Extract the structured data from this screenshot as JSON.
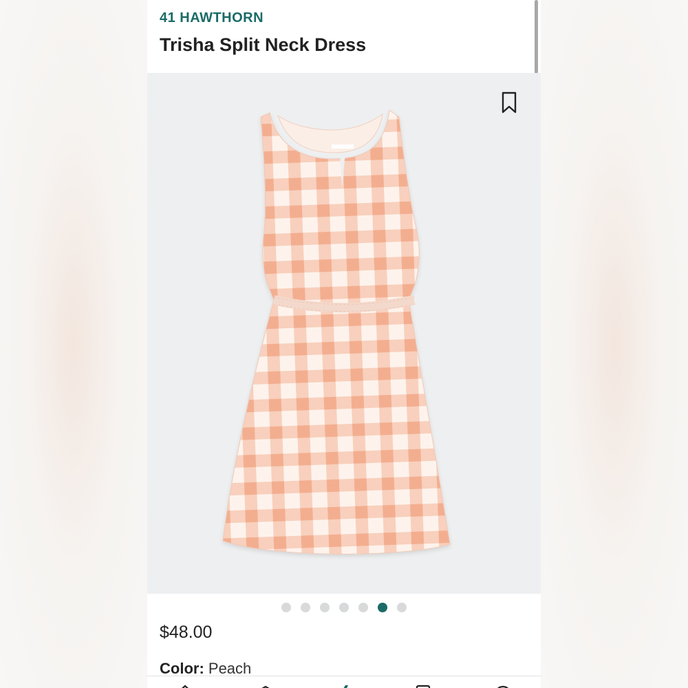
{
  "product": {
    "brand": "41 HAWTHORN",
    "name": "Trisha Split Neck Dress",
    "price": "$48.00",
    "color_label": "Color:",
    "color_value": "Peach"
  },
  "gallery": {
    "image_count": 7,
    "active_index": 5,
    "bookmark_icon": "bookmark-icon"
  },
  "bottom_nav": {
    "icons": [
      "home-icon",
      "box-icon",
      "stitchfix-icon",
      "bag-icon",
      "account-icon"
    ]
  },
  "colors": {
    "brand_accent": "#1a6b66",
    "dress_peach": "#f5b59a",
    "image_bg": "#eeeff0"
  }
}
